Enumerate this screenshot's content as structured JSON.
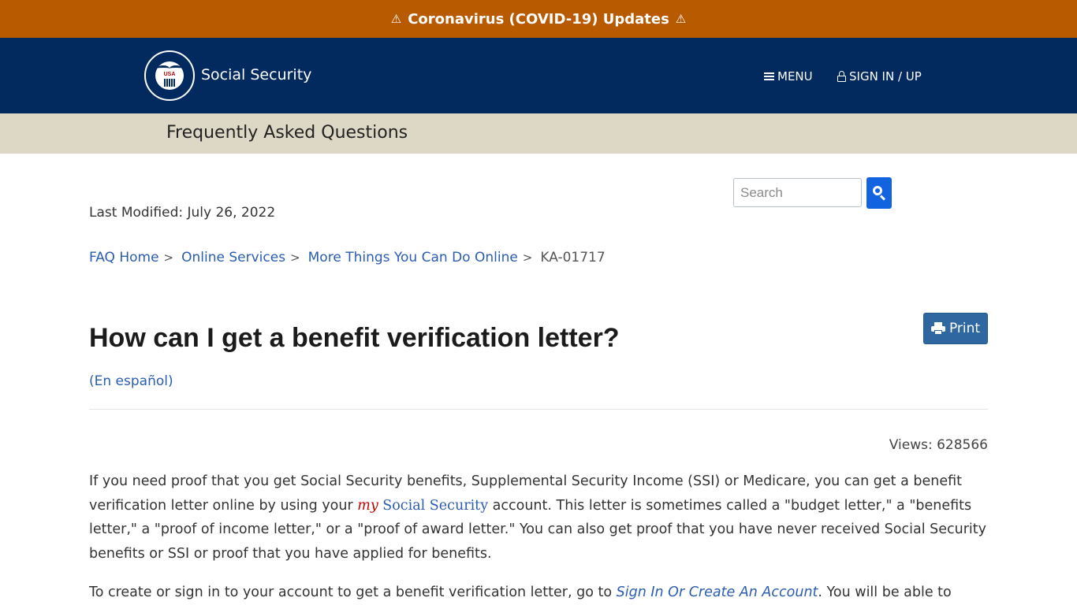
{
  "alert": {
    "text": "Coronavirus (COVID-19) Updates",
    "icon": "warning-icon"
  },
  "header": {
    "logo_title": "Social Security",
    "logo_seal_text": "USA",
    "menu_label": "MENU",
    "signin_label": "SIGN IN / UP"
  },
  "section_bar": {
    "title": "Frequently Asked Questions"
  },
  "search": {
    "placeholder": "Search",
    "value": ""
  },
  "meta": {
    "last_modified": "Last Modified: July 26, 2022",
    "views": "Views: 628566"
  },
  "breadcrumb": {
    "items": [
      {
        "label": "FAQ Home"
      },
      {
        "label": "Online Services"
      },
      {
        "label": "More Things You Can Do Online"
      }
    ],
    "separator": ">",
    "current": "KA-01717"
  },
  "article": {
    "title": "How can I get a benefit verification letter?",
    "print_label": "Print",
    "espanol_link": "(En español)",
    "para1": {
      "part1": "If you need proof that you get Social Security benefits, Supplemental Security Income (SSI) or Medicare, you can get a benefit verification letter online by using your ",
      "brand_my": "my",
      "brand_ss": " Social Security",
      "part2": " account. This letter is sometimes called a \"budget letter,\" a \"benefits letter,\" a \"proof of income letter,\" or a \"proof of award letter.\" You can also get proof that you have never received Social Security benefits or SSI or proof that you have applied for benefits."
    },
    "para2": {
      "part1": "To create or sign in to your account to get a benefit verification letter, go to ",
      "link": "Sign In Or Create An Account",
      "part2": ". You will be able to"
    }
  },
  "colors": {
    "alert_bg": "#b85a00",
    "header_bg": "#032a5f",
    "section_bar_bg": "#ddd8c5",
    "link": "#2a5db0",
    "search_button": "#1263e0",
    "print_button": "#2f67a0",
    "brand_my_red": "#c00000"
  }
}
